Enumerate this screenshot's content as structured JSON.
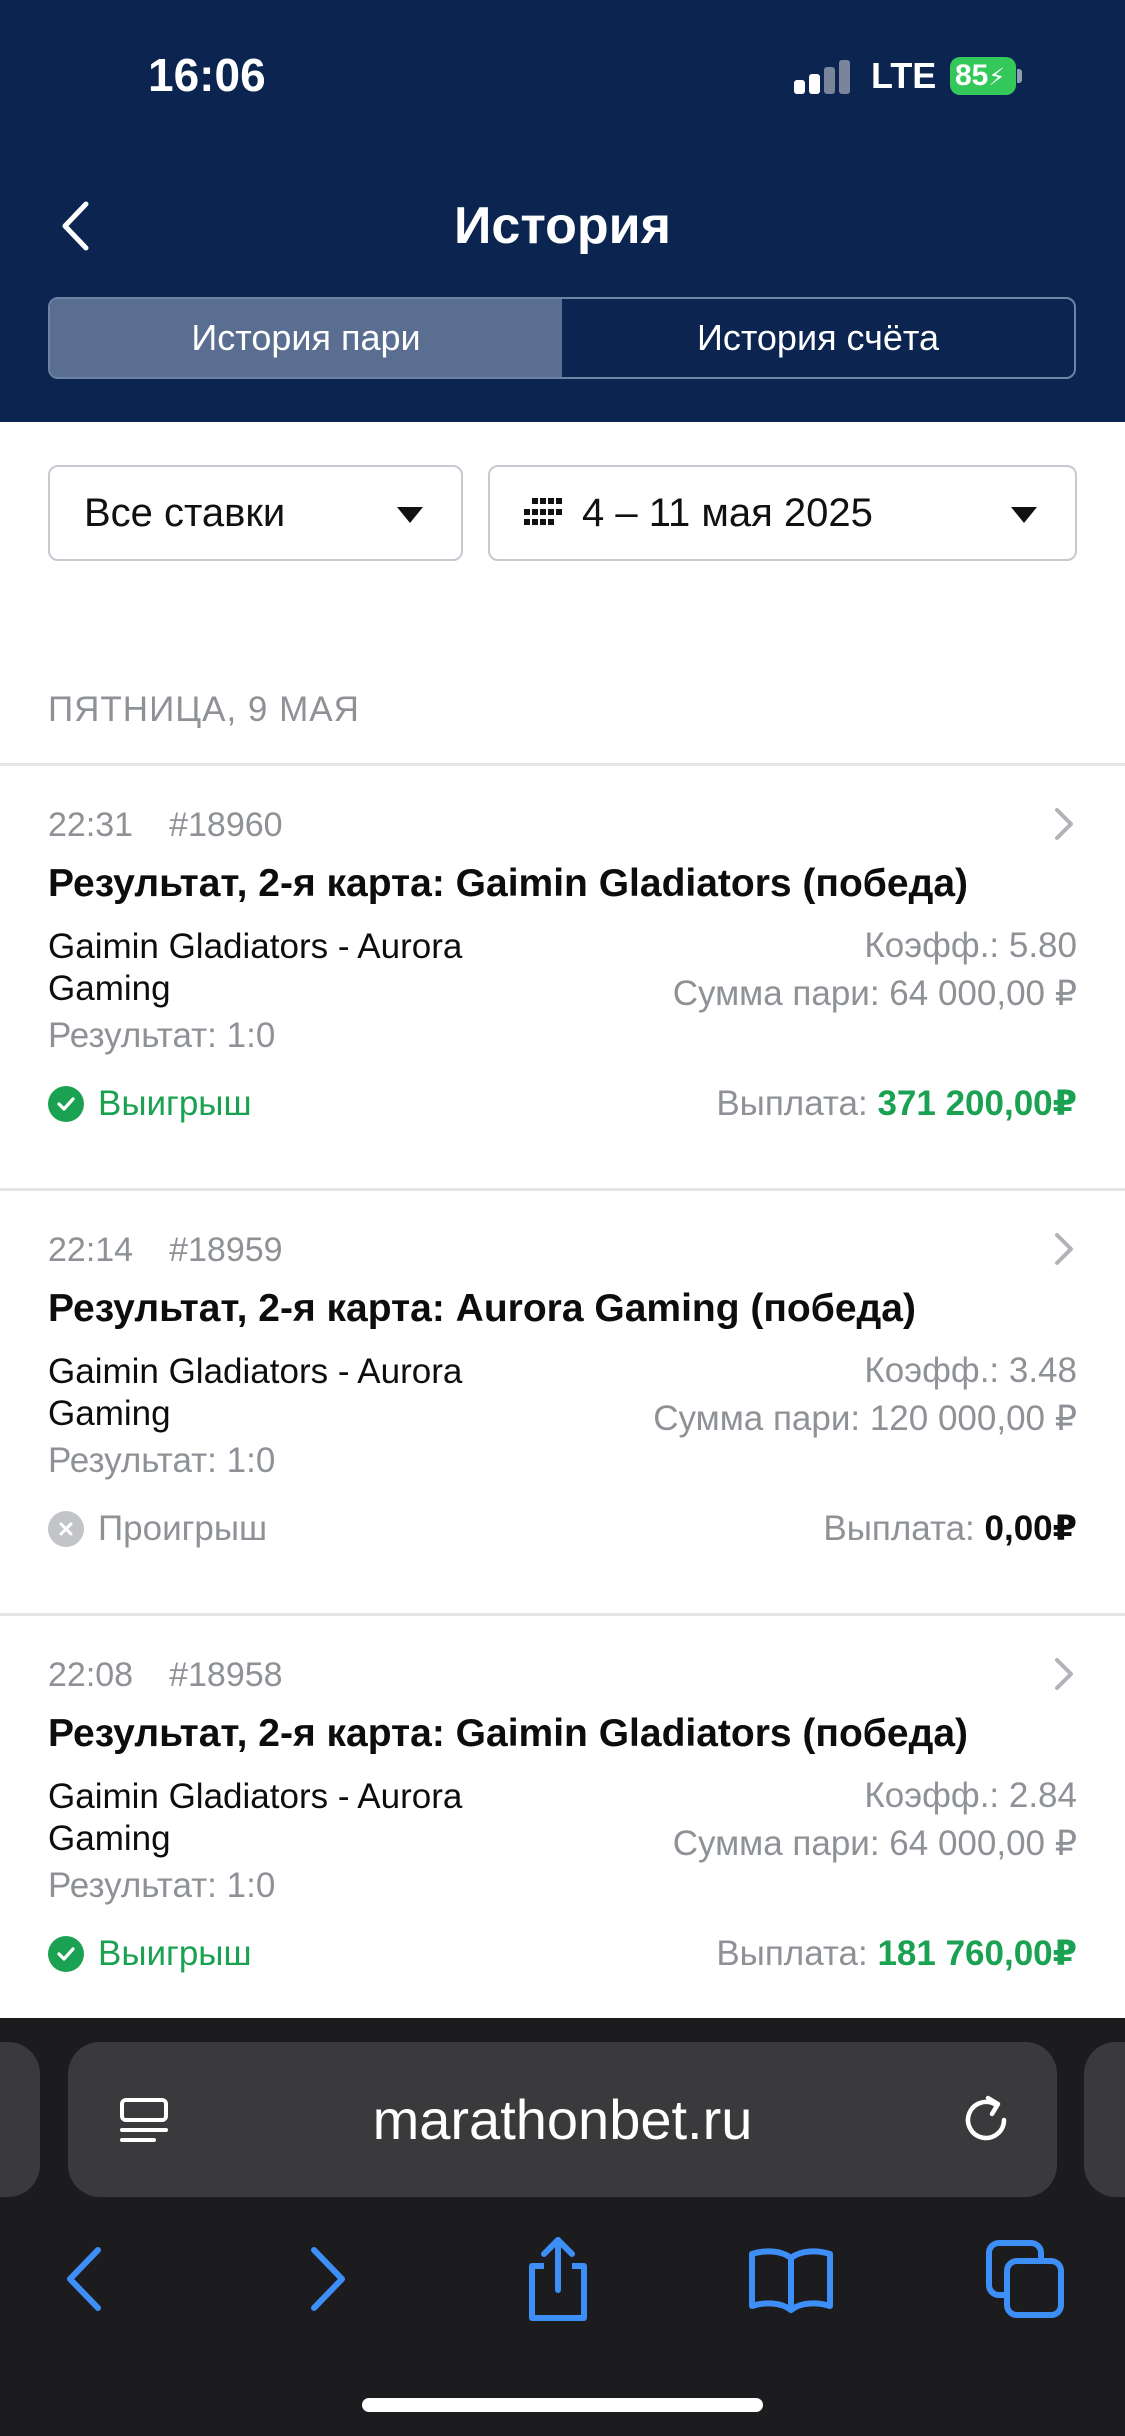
{
  "status_bar": {
    "time": "16:06",
    "network": "LTE",
    "battery": "85"
  },
  "header": {
    "title": "История",
    "tabs": [
      {
        "label": "История пари",
        "active": true
      },
      {
        "label": "История счёта",
        "active": false
      }
    ]
  },
  "filters": {
    "bet_type": "Все ставки",
    "date_range": "4 – 11 мая 2025"
  },
  "day_header": "ПЯТНИЦА, 9 МАЯ",
  "bets": [
    {
      "time": "22:31",
      "id": "#18960",
      "title": "Результат, 2-я карта: Gaimin Gladiators (победа)",
      "teams": "Gaimin Gladiators - Aurora Gaming",
      "result": "Результат: 1:0",
      "coef": "Коэфф.: 5.80",
      "stake": "Сумма пари: 64 000,00 ₽",
      "status": "Выигрыш",
      "payout_label": "Выплата:",
      "payout_value": "371 200,00₽",
      "won": true
    },
    {
      "time": "22:14",
      "id": "#18959",
      "title": "Результат, 2-я карта: Aurora Gaming (победа)",
      "teams": "Gaimin Gladiators - Aurora Gaming",
      "result": "Результат: 1:0",
      "coef": "Коэфф.: 3.48",
      "stake": "Сумма пари: 120 000,00 ₽",
      "status": "Проигрыш",
      "payout_label": "Выплата:",
      "payout_value": "0,00₽",
      "won": false
    },
    {
      "time": "22:08",
      "id": "#18958",
      "title": "Результат, 2-я карта: Gaimin Gladiators (победа)",
      "teams": "Gaimin Gladiators - Aurora Gaming",
      "result": "Результат: 1:0",
      "coef": "Коэфф.: 2.84",
      "stake": "Сумма пари: 64 000,00 ₽",
      "status": "Выигрыш",
      "payout_label": "Выплата:",
      "payout_value": "181 760,00₽",
      "won": true
    }
  ],
  "browser": {
    "url": "marathonbet.ru"
  },
  "colors": {
    "header_bg": "#0b2550",
    "win": "#1aa152",
    "lose": "#8e9196",
    "safari_icon": "#3d8ef7"
  }
}
